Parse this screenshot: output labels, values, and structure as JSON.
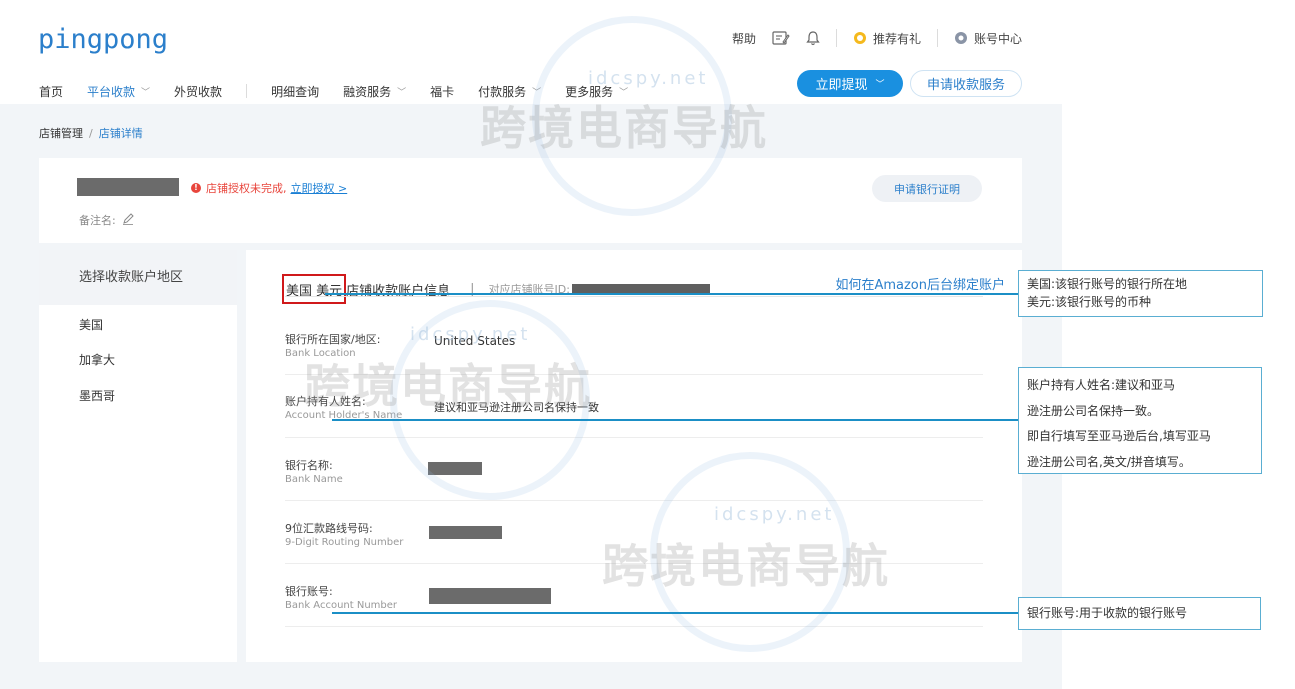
{
  "app": {
    "logo": "pingpong",
    "top_links": {
      "help": "帮助",
      "referral": "推荐有礼",
      "account_center": "账号中心"
    },
    "nav": [
      {
        "label": "首页",
        "active": false,
        "has_dropdown": false
      },
      {
        "label": "平台收款",
        "active": true,
        "has_dropdown": true
      },
      {
        "label": "外贸收款",
        "active": false,
        "has_dropdown": false
      },
      {
        "label": "明细查询",
        "active": false,
        "has_dropdown": false
      },
      {
        "label": "融资服务",
        "active": false,
        "has_dropdown": true
      },
      {
        "label": "福卡",
        "active": false,
        "has_dropdown": false
      },
      {
        "label": "付款服务",
        "active": false,
        "has_dropdown": true
      },
      {
        "label": "更多服务",
        "active": false,
        "has_dropdown": true
      }
    ],
    "withdraw_button": "立即提现",
    "apply_button": "申请收款服务",
    "accent_color": "#1a90e0"
  },
  "breadcrumb": {
    "parent": "店铺管理",
    "separator": "/",
    "current": "店铺详情"
  },
  "store_card": {
    "warning_text": "店铺授权未完成,",
    "authorize_link": "立即授权 >",
    "remark_label": "备注名:",
    "bank_cert_button": "申请银行证明"
  },
  "region_panel": {
    "title": "选择收款账户地区",
    "regions": [
      "美国",
      "加拿大",
      "墨西哥"
    ]
  },
  "account_info": {
    "country_tag": "美国 美元",
    "title": "店铺收款账户信息",
    "separator": "|",
    "store_id_label": "对应店铺账号ID:",
    "amazon_link": "如何在Amazon后台绑定账户",
    "fields": [
      {
        "label_zh": "银行所在国家/地区:",
        "label_en": "Bank Location",
        "value": "United States"
      },
      {
        "label_zh": "账户持有人姓名:",
        "label_en": "Account Holder's Name",
        "value": "建议和亚马逊注册公司名保持一致"
      },
      {
        "label_zh": "银行名称:",
        "label_en": "Bank Name",
        "value": ""
      },
      {
        "label_zh": "9位汇款路线号码:",
        "label_en": "9-Digit Routing Number",
        "value": ""
      },
      {
        "label_zh": "银行账号:",
        "label_en": "Bank Account Number",
        "value": ""
      }
    ]
  },
  "watermark": {
    "text": "跨境电商导航",
    "url": "idcspy.net"
  },
  "annotations": {
    "currency": {
      "line1": "美国:该银行账号的银行所在地",
      "line2": "美元:该银行账号的币种"
    },
    "holder": {
      "line1": "账户持有人姓名:建议和亚马",
      "line2": "逊注册公司名保持一致。",
      "line3": "即自行填写至亚马逊后台,填写亚马",
      "line4": "逊注册公司名,英文/拼音填写。"
    },
    "account": {
      "line1": "银行账号:用于收款的银行账号"
    }
  }
}
